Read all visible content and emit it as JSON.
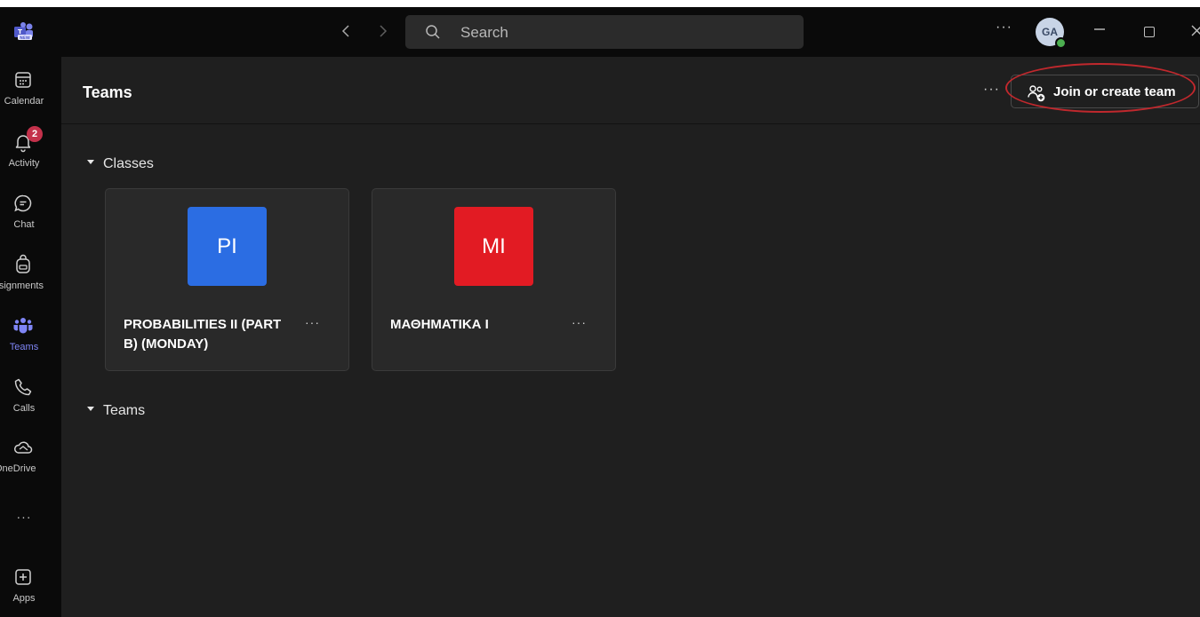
{
  "titlebar": {
    "search_placeholder": "Search",
    "more": "···",
    "avatar_initials": "GA"
  },
  "rail": {
    "items": [
      {
        "label": "Calendar",
        "icon": "calendar-icon"
      },
      {
        "label": "Activity",
        "icon": "bell-icon",
        "badge": "2"
      },
      {
        "label": "Chat",
        "icon": "chat-icon"
      },
      {
        "label": "Assignments",
        "icon": "backpack-icon"
      },
      {
        "label": "Teams",
        "icon": "teams-icon",
        "active": true
      },
      {
        "label": "Calls",
        "icon": "phone-icon"
      },
      {
        "label": "OneDrive",
        "icon": "cloud-icon"
      },
      {
        "label": "···",
        "icon": "more-icon"
      },
      {
        "label": "Apps",
        "icon": "apps-icon"
      }
    ]
  },
  "header": {
    "title": "Teams",
    "more": "···",
    "join_button_label": "Join or create team"
  },
  "sections": {
    "classes_label": "Classes",
    "teams_label": "Teams"
  },
  "classes": [
    {
      "initials": "PI",
      "name": "PROBABILITIES II (PART B) (MONDAY)",
      "tile_color": "#2b6de3",
      "more": "···"
    },
    {
      "initials": "MI",
      "name": "ΜΑΘΗΜΑΤΙΚΑ Ι",
      "tile_color": "#e21b23",
      "more": "···"
    }
  ],
  "colors": {
    "accent": "#7f85f5",
    "highlight_ring": "#c0282d",
    "badge": "#c4314b"
  }
}
